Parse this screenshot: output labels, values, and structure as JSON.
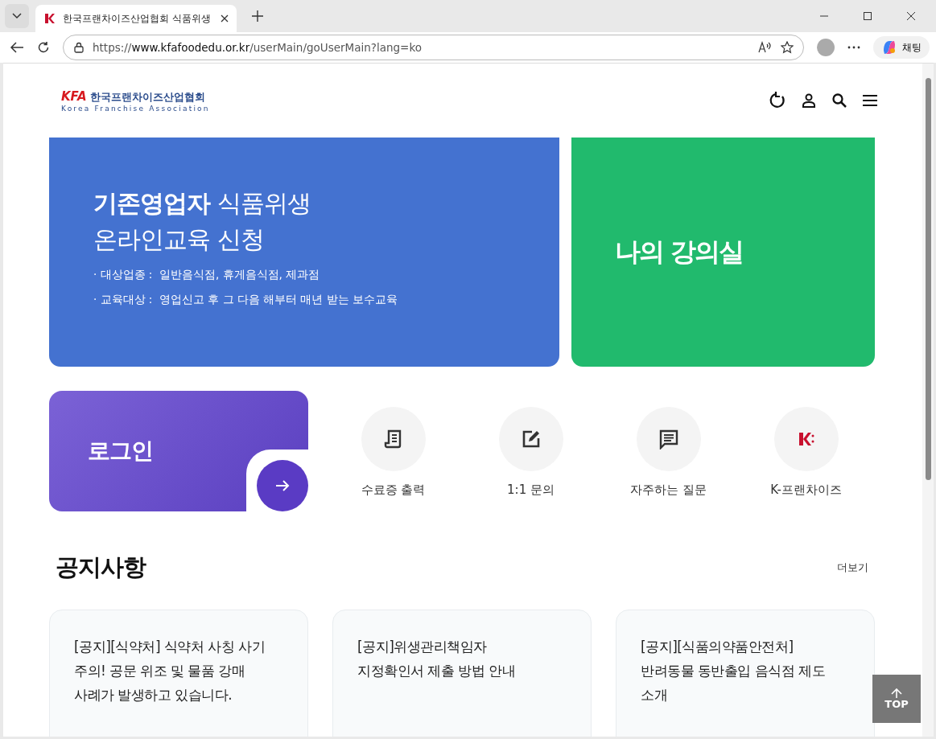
{
  "browser": {
    "tab_title": "한국프랜차이즈산업협회 식품위생",
    "url_prefix": "https://",
    "url_host": "www.kfafoodedu.or.kr",
    "url_path": "/userMain/goUserMain?lang=ko",
    "chat_label": "채팅"
  },
  "logo": {
    "mark": "KFA",
    "name_ko": "한국프랜차이즈산업협회",
    "name_en": "Korea Franchise Association"
  },
  "hero": {
    "title_bold": "기존영업자",
    "title_rest": "식품위생",
    "subtitle": "온라인교육 신청",
    "details": [
      {
        "label": "· 대상업종 :",
        "value": "일반음식점, 휴게음식점, 제과점"
      },
      {
        "label": "· 교육대상 :",
        "value": "영업신고 후 그 다음 해부터 매년 받는 보수교육"
      }
    ]
  },
  "classroom": {
    "title": "나의 강의실"
  },
  "login": {
    "title": "로그인"
  },
  "quick_links": [
    {
      "kind": "receipt",
      "label": "수료증 출력"
    },
    {
      "kind": "edit",
      "label": "1:1 문의"
    },
    {
      "kind": "chat",
      "label": "자주하는 질문"
    },
    {
      "kind": "brand",
      "label": "K-프랜차이즈"
    }
  ],
  "notices": {
    "title": "공지사항",
    "more": "더보기",
    "items": [
      {
        "title": "[공지][식약처] 식약처 사칭 사기 주의! 공문 위조 및 물품 강매 사례가 발생하고 있습니다."
      },
      {
        "title": "[공지]위생관리책임자 지정확인서 제출 방법 안내"
      },
      {
        "title": "[공지][식품의약품안전처] 반려동물 동반출입 음식점 제도 소개"
      }
    ]
  },
  "top_button": "TOP"
}
